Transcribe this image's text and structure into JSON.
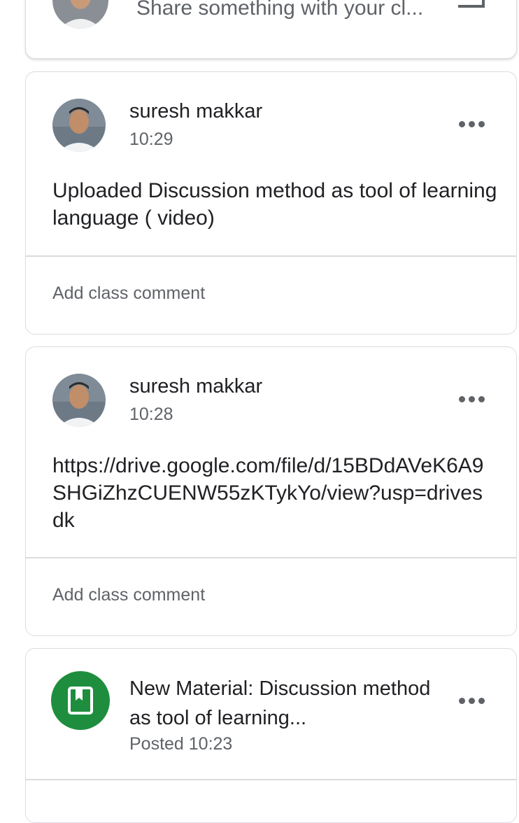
{
  "share": {
    "placeholder_text": "Share something with your cl..."
  },
  "posts": [
    {
      "author": "suresh makkar",
      "time": "10:29",
      "text": "Uploaded Discussion method as tool of learning language ( video)",
      "comment_placeholder": "Add class comment"
    },
    {
      "author": "suresh makkar",
      "time": "10:28",
      "text": "https://drive.google.com/file/d/15BDdAVeK6A9SHGiZhzCUENW55zKTykYo/view?usp=drivesdk",
      "comment_placeholder": "Add class comment"
    }
  ],
  "material": {
    "title": "New Material: Discussion method as tool of learning...",
    "posted": "Posted 10:23",
    "icon": "material-bookmark-icon",
    "icon_color": "#1e8e3e"
  },
  "colors": {
    "text_primary": "#202124",
    "text_secondary": "#5f6368",
    "border": "#dadce0"
  }
}
